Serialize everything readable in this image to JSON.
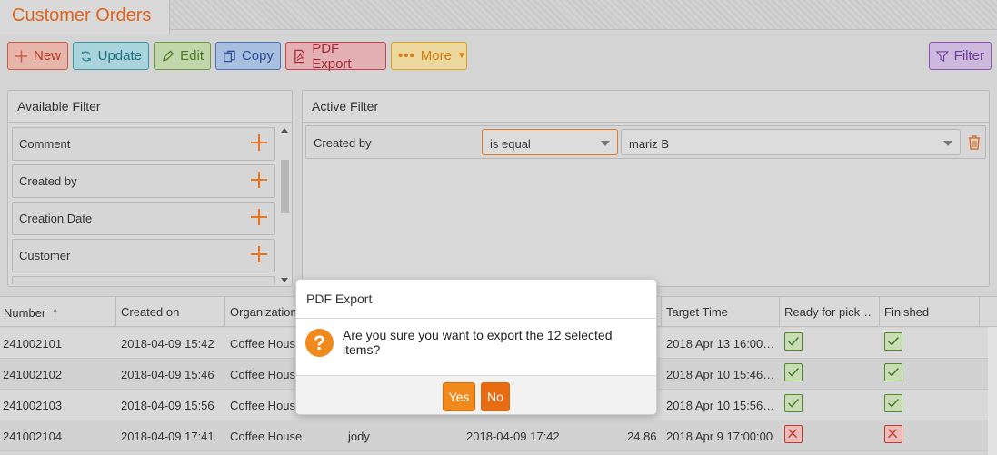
{
  "tab": {
    "title": "Customer Orders"
  },
  "toolbar": {
    "new_label": "New",
    "update_label": "Update",
    "edit_label": "Edit",
    "copy_label": "Copy",
    "pdf_label": "PDF Export",
    "more_label": "More",
    "filter_label": "Filter"
  },
  "available_filter": {
    "title": "Available Filter",
    "items": [
      "Comment",
      "Created by",
      "Creation Date",
      "Customer"
    ]
  },
  "active_filter": {
    "title": "Active Filter",
    "field": "Created by",
    "operator": "is equal",
    "value": "mariz B"
  },
  "table": {
    "columns": [
      "Number",
      "Created on",
      "Organization",
      "",
      "",
      "",
      "Target Time",
      "Ready for pick…",
      "Finished"
    ],
    "rows": [
      {
        "number": "241002101",
        "created_on": "2018-04-09 15:42",
        "organization": "Coffee House",
        "user": "",
        "date": "",
        "amount": "",
        "target_time": "2018 Apr 13 16:00…",
        "ready": true,
        "finished": true
      },
      {
        "number": "241002102",
        "created_on": "2018-04-09 15:46",
        "organization": "Coffee House",
        "user": "",
        "date": "",
        "amount": "",
        "target_time": "2018 Apr 10 15:46…",
        "ready": true,
        "finished": true
      },
      {
        "number": "241002103",
        "created_on": "2018-04-09 15:56",
        "organization": "Coffee House",
        "user": "",
        "date": "",
        "amount": "",
        "target_time": "2018 Apr 10 15:56…",
        "ready": true,
        "finished": true
      },
      {
        "number": "241002104",
        "created_on": "2018-04-09 17:41",
        "organization": "Coffee House",
        "user": "jody",
        "date": "2018-04-09 17:42",
        "amount": "24.86",
        "target_time": "2018 Apr 9 17:00:00",
        "ready": false,
        "finished": false
      }
    ]
  },
  "dialog": {
    "title": "PDF Export",
    "message": "Are you sure you want to export the 12 selected items?",
    "yes_label": "Yes",
    "no_label": "No"
  },
  "colors": {
    "accent": "#e0631b",
    "ok": "#4f8a2d",
    "error": "#c0392b",
    "button_orange": "#f08a1c"
  }
}
